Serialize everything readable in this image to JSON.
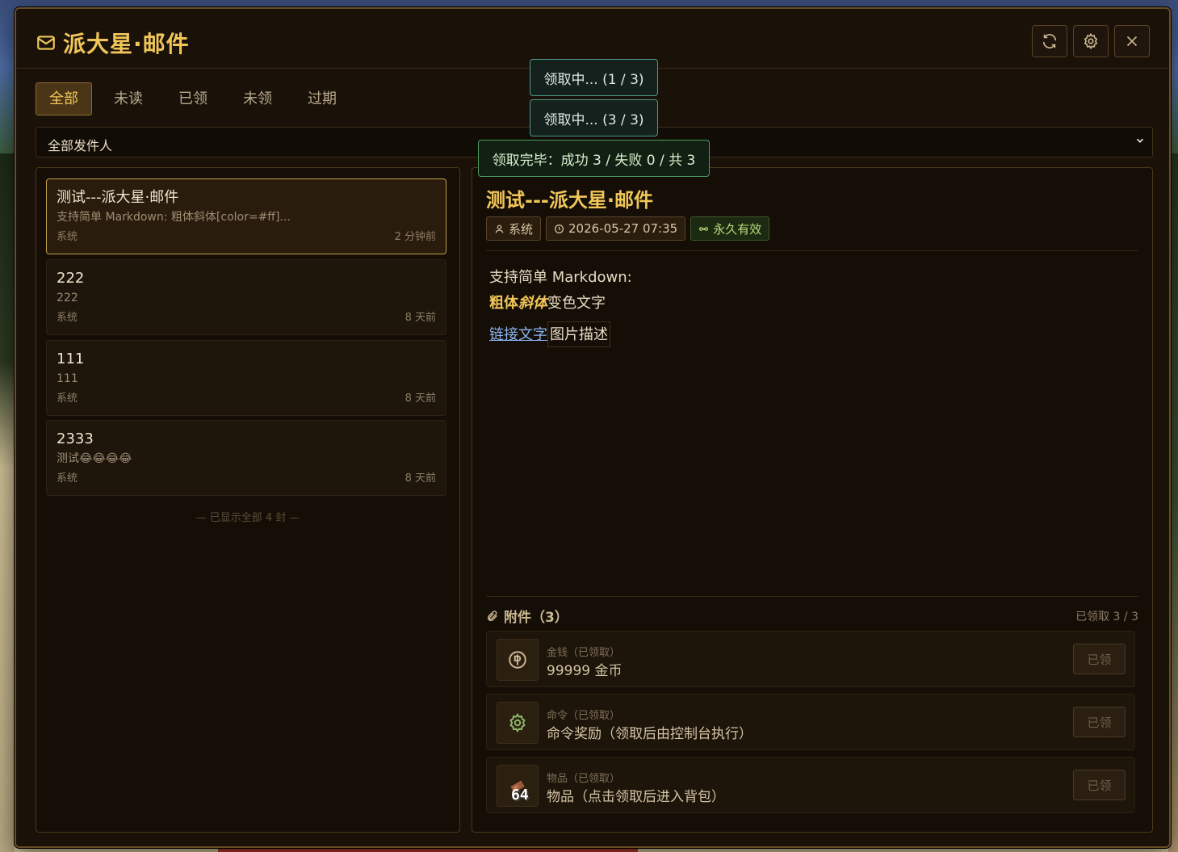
{
  "header": {
    "title": "派大星·邮件",
    "buttons": [
      "refresh-icon",
      "gear-icon",
      "close-icon"
    ]
  },
  "tabs": [
    {
      "label": "全部",
      "active": true
    },
    {
      "label": "未读"
    },
    {
      "label": "已领"
    },
    {
      "label": "未领"
    },
    {
      "label": "过期"
    }
  ],
  "filter": {
    "selected": "全部发件人"
  },
  "mails": [
    {
      "title": "测试---派大星·邮件",
      "preview": "支持简单 Markdown: 粗体斜体[color=#ff]...",
      "sender": "系统",
      "time": "2 分钟前"
    },
    {
      "title": "222",
      "preview": "222",
      "sender": "系统",
      "time": "8 天前"
    },
    {
      "title": "111",
      "preview": "111",
      "sender": "系统",
      "time": "8 天前"
    },
    {
      "title": "2333",
      "preview": "测试😂😂😂😂",
      "sender": "系统",
      "time": "8 天前"
    }
  ],
  "list_footer": "— 已显示全部 4 封 —",
  "detail": {
    "title": "测试---派大星·邮件",
    "sender": "系统",
    "datetime": "2026-05-27 07:35",
    "validity": "永久有效",
    "body": {
      "line1": "支持简单 Markdown:",
      "bold": "粗体",
      "italic": "斜体",
      "colored": "变色文字",
      "link": "链接文字",
      "image_alt": "图片描述"
    },
    "attachments": {
      "title": "附件（3）",
      "claimed_status": "已领取 3 / 3",
      "items": [
        {
          "type": "金钱（已领取）",
          "name": "99999 金币",
          "icon": "coin-icon",
          "button": "已领"
        },
        {
          "type": "命令（已领取）",
          "name": "命令奖励（领取后由控制台执行）",
          "icon": "gear-icon",
          "button": "已领"
        },
        {
          "type": "物品（已领取）",
          "name": "物品（点击领取后进入背包）",
          "icon": "item-icon",
          "stack": "64",
          "button": "已领"
        }
      ]
    }
  },
  "toasts": [
    "领取中... (1 / 3)",
    "领取中... (3 / 3)",
    "领取完毕：成功 3 / 失败 0 / 共 3"
  ],
  "colors": {
    "accent": "#f0c659",
    "background": "#1a1109",
    "border": "#6a4e27",
    "success": "#b7de7a",
    "link": "#8ab4f0"
  }
}
